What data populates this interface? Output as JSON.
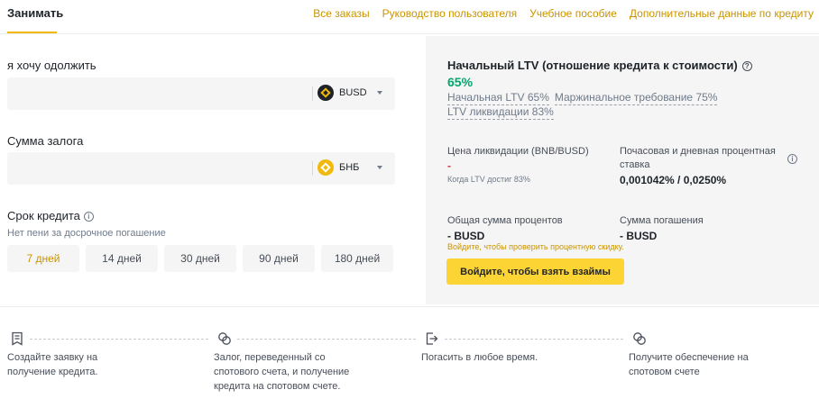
{
  "tabs": {
    "active": "Занимать"
  },
  "top_links": [
    "Все заказы",
    "Руководство пользователя",
    "Учебное пособие",
    "Дополнительные данные по кредиту"
  ],
  "borrow": {
    "label": "я хочу одолжить",
    "coin": "BUSD",
    "coin_icon": "busd-coin-icon"
  },
  "collateral": {
    "label": "Сумма залога",
    "coin": "БНБ",
    "coin_icon": "bnb-coin-icon"
  },
  "term": {
    "label": "Срок кредита",
    "hint": "Нет пени за досрочное погашение",
    "options": [
      "7 дней",
      "14 дней",
      "30 дней",
      "90 дней",
      "180 дней"
    ],
    "selected": "7 дней"
  },
  "panel": {
    "title": "Начальный LTV (отношение кредита к стоимости)",
    "ltv_value": "65%",
    "meta": [
      "Начальная LTV 65%",
      "Маржинальное требование 75%",
      "LTV ликвидации 83%"
    ],
    "liq_price_label": "Цена ликвидации (BNB/BUSD)",
    "liq_price_value": "-",
    "liq_price_note": "Когда LTV достиг 83%",
    "rate_label": "Почасовая и дневная процентная ставка",
    "rate_value": "0,001042% / 0,0250%",
    "total_interest_label": "Общая сумма процентов",
    "total_interest_value": "- BUSD",
    "repay_label": "Сумма погашения",
    "repay_value": "- BUSD",
    "login_note": "Войдите, чтобы проверить процентную скидку.",
    "cta": "Войдите, чтобы взять взаймы"
  },
  "steps": [
    {
      "icon": "application-icon",
      "text_1": "Создайте заявку на",
      "text_2": "получение кредита.",
      "text_3": ""
    },
    {
      "icon": "collateral-icon",
      "text_1": "Залог, переведенный со",
      "text_2": "спотового счета, и получение",
      "text_3": "кредита на спотовом счете."
    },
    {
      "icon": "repay-icon",
      "text_1": "Погасить в любое время.",
      "text_2": "",
      "text_3": ""
    },
    {
      "icon": "receive-collateral-icon",
      "text_1": "Получите обеспечение на",
      "text_2": "спотовом счете",
      "text_3": ""
    }
  ],
  "colors": {
    "accent": "#f0b90b",
    "link": "#c99400",
    "positive": "#03a66d",
    "negative": "#cf304a",
    "button": "#fcd535"
  }
}
